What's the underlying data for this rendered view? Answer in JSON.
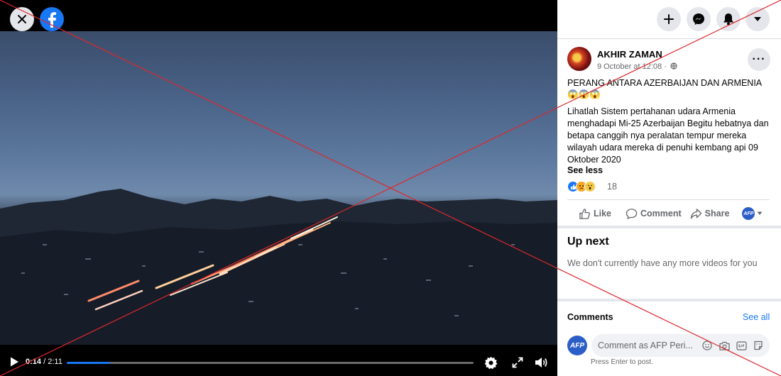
{
  "player": {
    "current_time": "0:14",
    "duration": "2:11",
    "progress_fraction": 0.107
  },
  "post": {
    "author": "AKHIR ZAMAN",
    "date": "9 October at 12:08 ·",
    "title": "PERANG ANTARA AZERBAIJAN DAN ARMENIA 😱😱😱",
    "body": "Lihatlah Sistem pertahanan udara Armenia menghadapi Mi-25 Azerbaijan Begitu hebatnya dan betapa canggih nya peralatan tempur mereka wilayah udara mereka di penuhi kembang api 09 Oktober 2020",
    "see_less": "See less",
    "reaction_count": "18",
    "reaction_icons": [
      "like-icon",
      "angry-icon",
      "wow-icon"
    ]
  },
  "actions": {
    "like": "Like",
    "comment": "Comment",
    "share": "Share"
  },
  "up_next": {
    "title": "Up next",
    "empty_message": "We don't currently have any more videos for you"
  },
  "comments": {
    "title": "Comments",
    "see_all": "See all",
    "avatar_label": "AFP",
    "placeholder": "Comment as AFP Peri...",
    "hint": "Press Enter to post."
  },
  "colors": {
    "brand": "#1877f2",
    "overlay_cross": "#e0262d"
  }
}
